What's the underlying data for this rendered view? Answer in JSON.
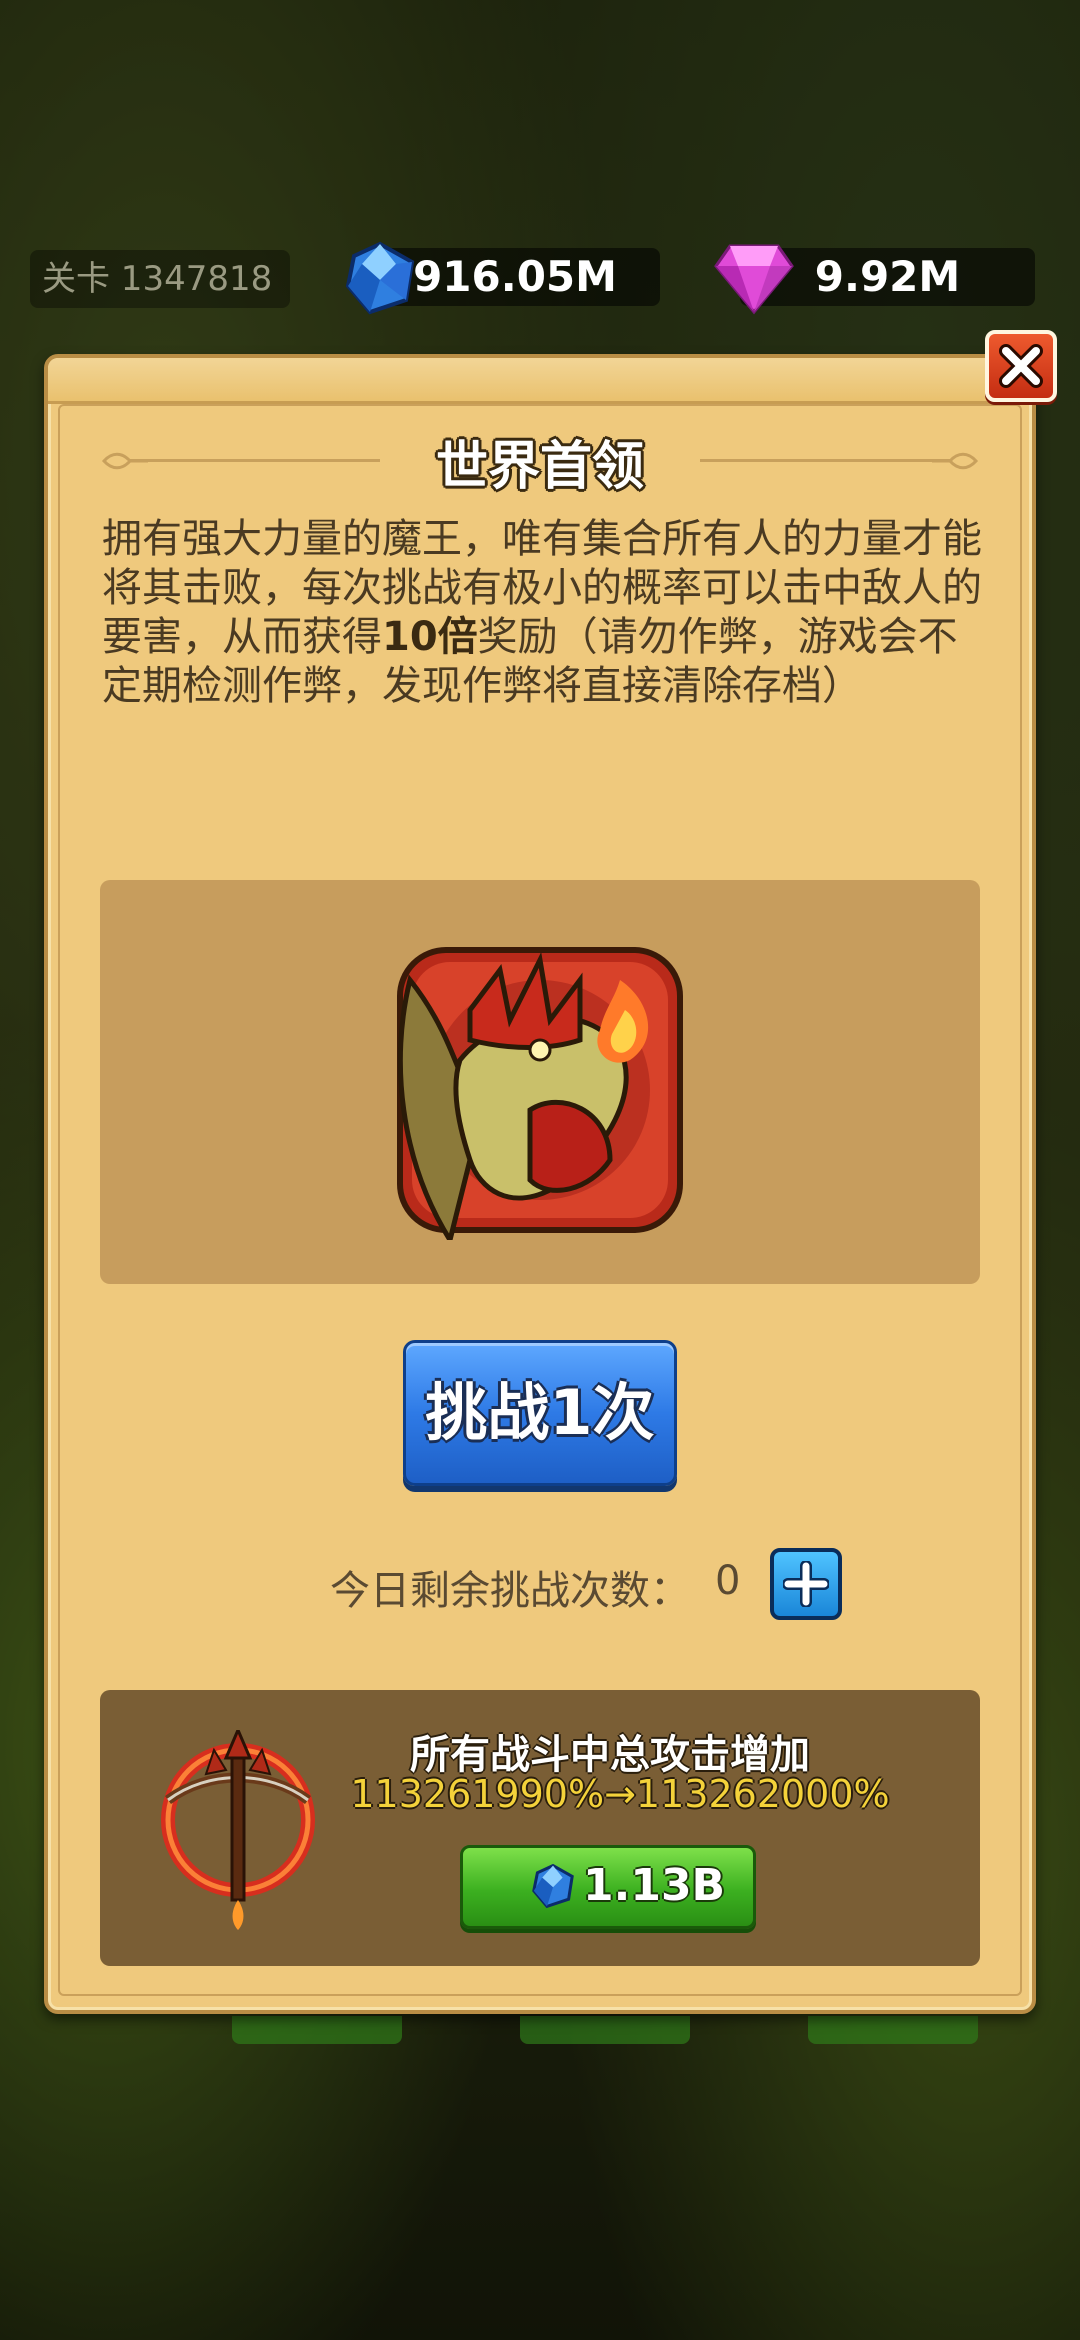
{
  "topbar": {
    "stage_label": "关卡 1347818",
    "crystal_icon": "blue-crystal-icon",
    "crystal_value": "916.05M",
    "gem_icon": "pink-gem-icon",
    "gem_value": "9.92M"
  },
  "dialog": {
    "title": "世界首领",
    "description_part1": "拥有强大力量的魔王，唯有集合所有人的力量才能将其击败，每次挑战有极小的概率可以击中敌人的要害，从而获得",
    "description_bold": "10倍",
    "description_part2": "奖励（请勿作弊，游戏会不定期检测作弊，发现作弊将直接清除存档）",
    "boss_icon": "red-dragon-boss-icon",
    "challenge_button": "挑战1次",
    "remaining_label": "今日剩余挑战次数：",
    "remaining_count": "0",
    "upgrade": {
      "icon": "flaming-crossbow-icon",
      "title": "所有战斗中总攻击增加",
      "value_change": "113261990%→113262000%",
      "cost": "1.13B"
    }
  },
  "colors": {
    "dialog_bg": "#efc97d",
    "challenge_button": "#2e7ae6",
    "buy_button": "#3cb020",
    "close_button": "#d8401c"
  }
}
